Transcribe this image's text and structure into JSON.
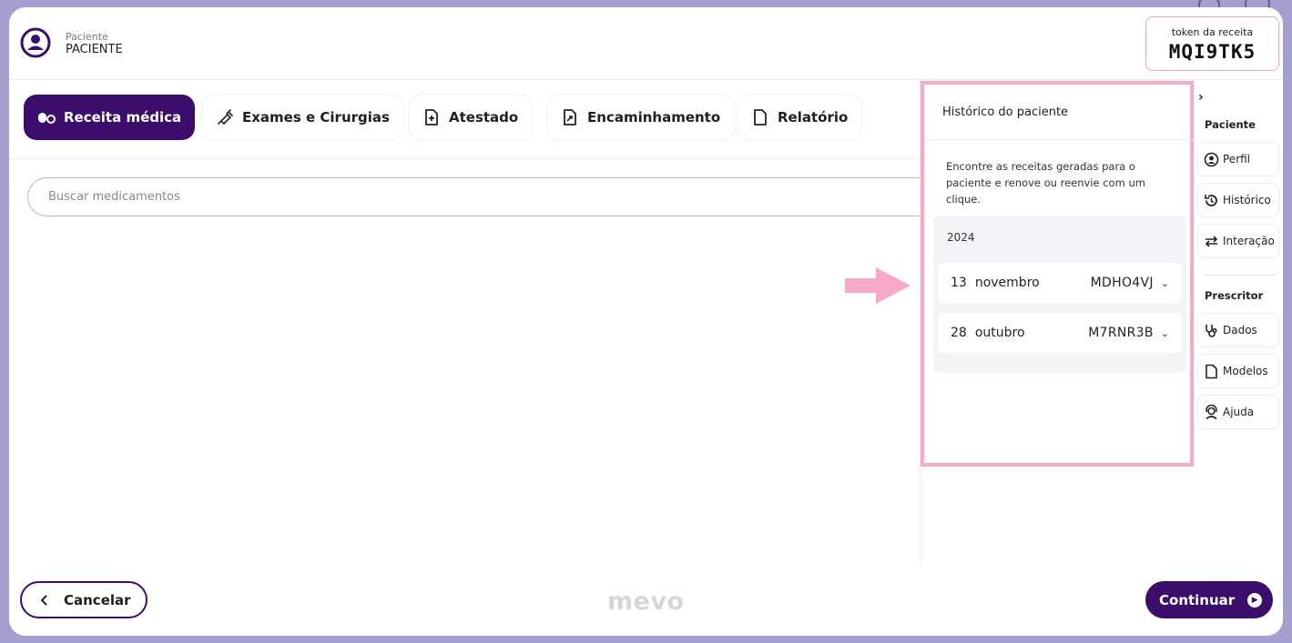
{
  "patient": {
    "label": "Paciente",
    "name": "PACIENTE"
  },
  "token": {
    "label": "token da receita",
    "value": "MQI9TK5"
  },
  "tabs": [
    {
      "label": "Receita médica",
      "icon": "pills-icon",
      "active": true
    },
    {
      "label": "Exames e Cirurgias",
      "icon": "syringe-icon",
      "active": false
    },
    {
      "label": "Atestado",
      "icon": "document-plus-icon",
      "active": false
    },
    {
      "label": "Encaminhamento",
      "icon": "document-arrow-icon",
      "active": false
    },
    {
      "label": "Relatório",
      "icon": "document-icon",
      "active": false
    }
  ],
  "search": {
    "placeholder": "Buscar medicamentos"
  },
  "history": {
    "title": "Histórico do paciente",
    "description": "Encontre as receitas geradas para o paciente e renove ou reenvie com um clique.",
    "year": "2024",
    "entries": [
      {
        "day": "13",
        "month": "novembro",
        "code": "MDHO4VJ"
      },
      {
        "day": "28",
        "month": "outubro",
        "code": "M7RNR3B"
      }
    ]
  },
  "rail": {
    "toggle": "›",
    "patient_section": "Paciente",
    "patient_items": [
      {
        "label": "Perfil",
        "icon": "user-circle-icon"
      },
      {
        "label": "Histórico",
        "icon": "history-icon"
      },
      {
        "label": "Interação",
        "icon": "swap-arrows-icon"
      }
    ],
    "prescriber_section": "Prescritor",
    "prescriber_items": [
      {
        "label": "Dados",
        "icon": "stethoscope-icon"
      },
      {
        "label": "Modelos",
        "icon": "document-icon"
      },
      {
        "label": "Ajuda",
        "icon": "support-agent-icon"
      }
    ]
  },
  "footer": {
    "cancel_label": "Cancelar",
    "brand": "mevo",
    "continue_label": "Continuar"
  },
  "colors": {
    "primary": "#3b0e6b",
    "highlight_border": "#f6a9c8",
    "arrow": "#f6a9c8",
    "backdrop": "#a59fd0"
  }
}
